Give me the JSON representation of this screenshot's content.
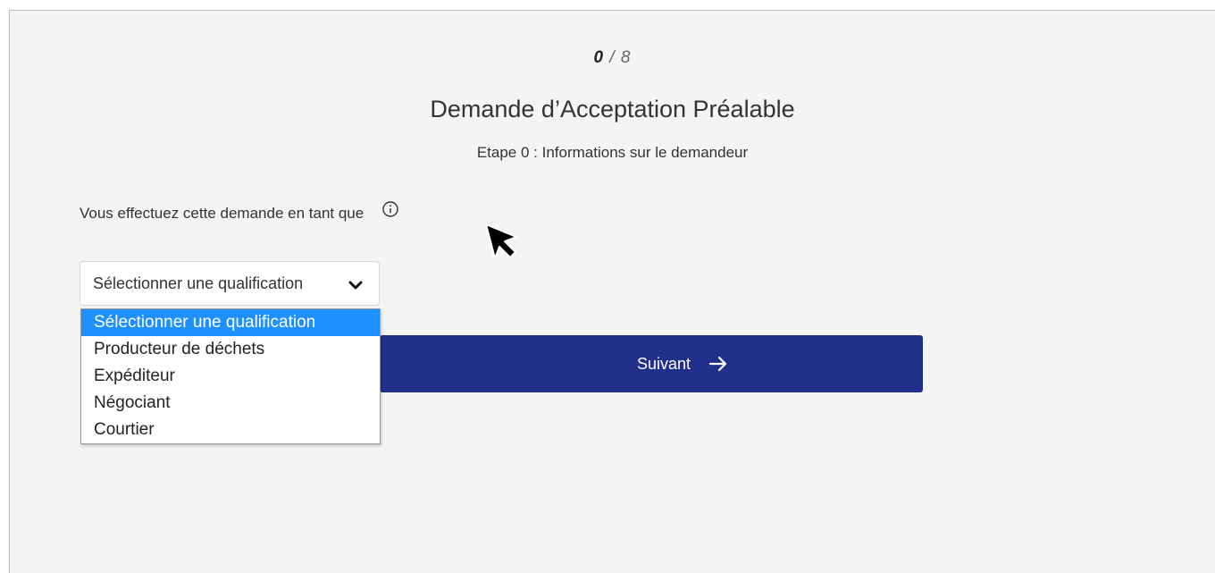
{
  "progress": {
    "current": "0",
    "separator": "/",
    "total": "8"
  },
  "form": {
    "title": "Demande d’Acceptation Préalable",
    "step_label": "Etape 0 : Informations sur le demandeur",
    "question_label": "Vous effectuez cette demande en tant que",
    "select": {
      "selected_value": "Sélectionner une qualification",
      "options": [
        "Sélectionner une qualification",
        "Producteur de déchets",
        "Expéditeur",
        "Négociant",
        "Courtier"
      ],
      "highlighted_index": 0
    },
    "next_button": {
      "label": "Suivant"
    }
  },
  "icons": {
    "info": "info-icon",
    "chevron": "chevron-down-icon",
    "arrow": "arrow-right-icon",
    "cursor": "mouse-cursor-icon"
  },
  "colors": {
    "page_background": "#f4f4f4",
    "primary_button": "#21318b",
    "option_highlight": "#1e90ff"
  }
}
